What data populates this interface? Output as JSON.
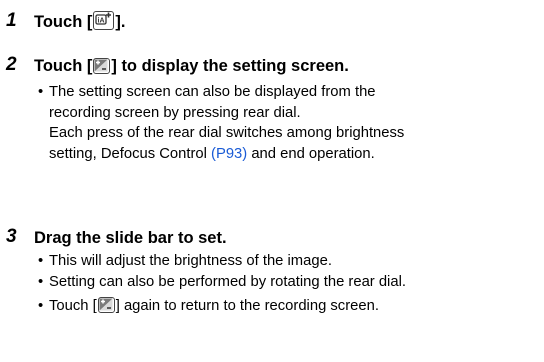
{
  "steps": [
    {
      "number": "1",
      "text_before": "Touch [",
      "icon": "intelligent-auto-plus-icon",
      "text_after": "]."
    },
    {
      "number": "2",
      "text_before": "Touch [",
      "icon": "exposure-compensation-icon",
      "text_after": "] to display the setting screen.",
      "bullets": [
        {
          "lines": [
            "The setting screen can also be displayed from the",
            "recording screen by pressing rear dial.",
            "Each press of the rear dial switches among brightness"
          ],
          "last_line_before_link": "setting, Defocus Control ",
          "link": "(P93)",
          "last_line_after_link": " and end operation."
        }
      ]
    },
    {
      "number": "3",
      "text": "Drag the slide bar to set.",
      "bullets": [
        "This will adjust the brightness of the image.",
        "Setting can also be performed by rotating the rear dial."
      ],
      "last_bullet_before": "Touch [",
      "last_bullet_icon": "exposure-compensation-icon",
      "last_bullet_after": "] again to return to the recording screen."
    }
  ],
  "colors": {
    "link": "#1a5bd6",
    "text": "#000000"
  }
}
